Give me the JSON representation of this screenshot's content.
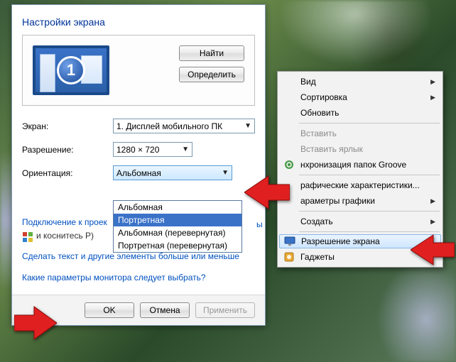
{
  "dialog": {
    "title": "Настройки экрана",
    "monitor_number": "1",
    "find_btn": "Найти",
    "detect_btn": "Определить",
    "labels": {
      "screen": "Экран:",
      "resolution": "Разрешение:",
      "orientation": "Ориентация:"
    },
    "screen_value": "1. Дисплей мобильного ПК",
    "resolution_value": "1280 × 720",
    "orientation_value": "Альбомная",
    "orientation_options": [
      "Альбомная",
      "Портретная",
      "Альбомная (перевернутая)",
      "Портретная (перевернутая)"
    ],
    "orientation_selected_index": 1,
    "hint_partial_y": "ы",
    "link_projector": "Подключение к проек",
    "projector_hint": "и коснитесь P)",
    "link_text_size": "Сделать текст и другие элементы больше или меньше",
    "link_monitor_params": "Какие параметры монитора следует выбрать?",
    "ok_btn": "OK",
    "cancel_btn": "Отмена",
    "apply_btn": "Применить"
  },
  "context_menu": {
    "view": "Вид",
    "sort": "Сортировка",
    "refresh": "Обновить",
    "paste": "Вставить",
    "paste_shortcut": "Вставить ярлык",
    "groove": "нхронизация папок Groove",
    "graphics_props": "рафические характеристики...",
    "graphics_params": "араметры графики",
    "new": "Создать",
    "resolution": "Разрешение экрана",
    "gadgets": "Гаджеты"
  }
}
